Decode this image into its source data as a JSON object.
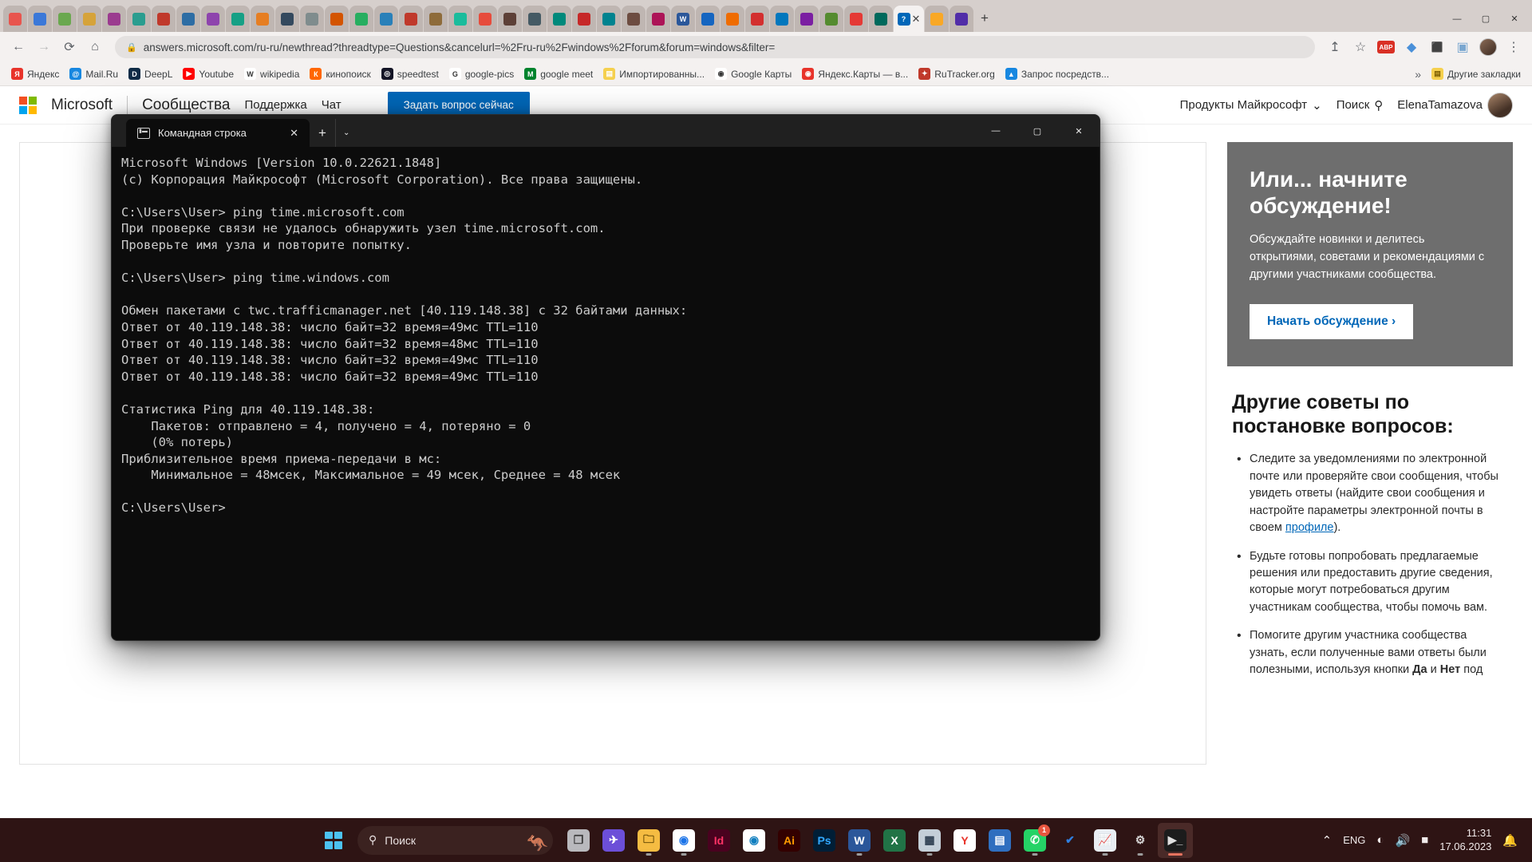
{
  "browser": {
    "tabs": [
      {
        "label": "",
        "color": "#e8554e"
      },
      {
        "label": "",
        "color": "#3b78d8"
      },
      {
        "label": "",
        "color": "#6aa84f"
      },
      {
        "label": "",
        "color": "#d6a33a"
      },
      {
        "label": "",
        "color": "#9b3b8f"
      },
      {
        "label": "",
        "color": "#2a9d8f"
      },
      {
        "label": "",
        "color": "#c0392b"
      },
      {
        "label": "",
        "color": "#2e6da4"
      },
      {
        "label": "",
        "color": "#8e44ad"
      },
      {
        "label": "",
        "color": "#16a085"
      },
      {
        "label": "",
        "color": "#e67e22"
      },
      {
        "label": "",
        "color": "#34495e"
      },
      {
        "label": "",
        "color": "#7f8c8d"
      },
      {
        "label": "",
        "color": "#d35400"
      },
      {
        "label": "",
        "color": "#27ae60"
      },
      {
        "label": "",
        "color": "#2980b9"
      },
      {
        "label": "",
        "color": "#c0392b"
      },
      {
        "label": "",
        "color": "#8e6b3a"
      },
      {
        "label": "",
        "color": "#1abc9c"
      },
      {
        "label": "",
        "color": "#e74c3c"
      },
      {
        "label": "",
        "color": "#5d4037"
      },
      {
        "label": "",
        "color": "#455a64"
      },
      {
        "label": "",
        "color": "#00897b"
      },
      {
        "label": "",
        "color": "#c62828"
      },
      {
        "label": "",
        "color": "#00838f"
      },
      {
        "label": "",
        "color": "#6d4c41"
      },
      {
        "label": "",
        "color": "#ad1457"
      },
      {
        "label": "W",
        "color": "#2b579a"
      },
      {
        "label": "",
        "color": "#1565c0"
      },
      {
        "label": "",
        "color": "#ef6c00"
      },
      {
        "label": "",
        "color": "#d32f2f"
      },
      {
        "label": "",
        "color": "#0277bd"
      },
      {
        "label": "",
        "color": "#7b1fa2"
      },
      {
        "label": "",
        "color": "#558b2f"
      },
      {
        "label": "",
        "color": "#e53935"
      },
      {
        "label": "",
        "color": "#00695c"
      },
      {
        "label": "?",
        "color": "#0067b8"
      },
      {
        "label": "",
        "color": "#f9a825"
      },
      {
        "label": "",
        "color": "#512da8"
      }
    ],
    "active_tab_label": "",
    "tab_close_glyph": "✕",
    "new_tab_glyph": "+",
    "window_minimize": "—",
    "window_maximize": "▢",
    "window_close": "✕",
    "nav": {
      "back": "←",
      "forward": "→",
      "reload": "⟳",
      "home": "⌂"
    },
    "omnibox": {
      "lock_glyph": "🔒",
      "url": "answers.microsoft.com/ru-ru/newthread?threadtype=Questions&cancelurl=%2Fru-ru%2Fwindows%2Fforum&forum=windows&filter=",
      "share_glyph": "↥",
      "star_glyph": "☆"
    },
    "toolbar_right": {
      "adblock_label": "ABP",
      "ext1_glyph": "◆",
      "ext2_glyph": "⬛",
      "ext3_glyph": "▣",
      "menu_glyph": "⋮"
    },
    "bookmarks": [
      {
        "label": "Яндекс",
        "icon": "Я",
        "color": "#e8332a"
      },
      {
        "label": "Mail.Ru",
        "icon": "@",
        "color": "#1787e0"
      },
      {
        "label": "DeepL",
        "icon": "D",
        "color": "#0f2b46"
      },
      {
        "label": "Youtube",
        "icon": "▶",
        "color": "#ff0000"
      },
      {
        "label": "wikipedia",
        "icon": "W",
        "color": "#ffffff"
      },
      {
        "label": "кинопоиск",
        "icon": "К",
        "color": "#ff6600"
      },
      {
        "label": "speedtest",
        "icon": "◎",
        "color": "#141526"
      },
      {
        "label": "google-pics",
        "icon": "G",
        "color": "#ffffff"
      },
      {
        "label": "google meet",
        "icon": "M",
        "color": "#00832d"
      },
      {
        "label": "Импортированны...",
        "icon": "▤",
        "color": "#f5d04e"
      },
      {
        "label": "Google Карты",
        "icon": "◉",
        "color": "#ffffff"
      },
      {
        "label": "Яндекс.Карты — в...",
        "icon": "◉",
        "color": "#e8332a"
      },
      {
        "label": "RuTracker.org",
        "icon": "✦",
        "color": "#c0392b"
      },
      {
        "label": "Запрос посредств...",
        "icon": "▲",
        "color": "#1787e0"
      }
    ],
    "bookmarks_overflow": "»",
    "other_bookmarks": {
      "label": "Другие закладки",
      "icon": "▤"
    }
  },
  "ms_page": {
    "brand": "Microsoft",
    "nav_items": [
      "Сообщества",
      "Поддержка",
      "Чат"
    ],
    "ask_button": "Задать вопрос сейчас",
    "products_menu": "Продукты Майкрософт",
    "products_chevron": "⌄",
    "search_label": "Поиск",
    "search_icon": "search-icon",
    "account_name": "ElenaTamazova",
    "promo": {
      "title": "Или... начните обсуждение!",
      "text": "Обсуждайте новинки и делитесь открытиями, советами и рекомендациями с другими участниками сообщества.",
      "button": "Начать обсуждение",
      "button_chevron": "›"
    },
    "tips": {
      "title": "Другие советы по постановке вопросов:",
      "items": [
        {
          "pre": "Следите за уведомлениями по электронной почте или проверяйте свои сообщения, чтобы увидеть ответы (найдите свои сообщения и настройте параметры электронной почты в своем ",
          "link": "профиле",
          "post": ")."
        },
        {
          "pre": "Будьте готовы попробовать предлагаемые решения или предоставить другие сведения, которые могут потребоваться другим участникам сообщества, чтобы помочь вам.",
          "link": "",
          "post": ""
        },
        {
          "pre": "Помогите другим участника сообщества узнать, если полученные вами ответы были полезными, используя кнопки ",
          "bold1": "Да",
          "mid": " и ",
          "bold2": "Нет",
          "post": " под"
        }
      ]
    }
  },
  "cmd": {
    "tab_title": "Командная строка",
    "tab_icon": "terminal-icon",
    "tab_close": "✕",
    "new_tab": "+",
    "dropdown": "⌄",
    "minimize": "—",
    "maximize": "▢",
    "close": "✕",
    "output": "Microsoft Windows [Version 10.0.22621.1848]\n(c) Корпорация Майкрософт (Microsoft Corporation). Все права защищены.\n\nC:\\Users\\User> ping time.microsoft.com\nПри проверке связи не удалось обнаружить узел time.microsoft.com.\nПроверьте имя узла и повторите попытку.\n\nC:\\Users\\User> ping time.windows.com\n\nОбмен пакетами с twc.trafficmanager.net [40.119.148.38] с 32 байтами данных:\nОтвет от 40.119.148.38: число байт=32 время=49мс TTL=110\nОтвет от 40.119.148.38: число байт=32 время=48мс TTL=110\nОтвет от 40.119.148.38: число байт=32 время=49мс TTL=110\nОтвет от 40.119.148.38: число байт=32 время=49мс TTL=110\n\nСтатистика Ping для 40.119.148.38:\n    Пакетов: отправлено = 4, получено = 4, потеряно = 0\n    (0% потерь)\nПриблизительное время приема-передачи в мс:\n    Минимальное = 48мсек, Максимальное = 49 мсек, Среднее = 48 мсек\n\nC:\\Users\\User>"
  },
  "taskbar": {
    "start_icon": "windows-logo-icon",
    "search_placeholder": "Поиск",
    "search_icon": "search-icon",
    "decoration": "🦘",
    "apps": [
      {
        "name": "task-view",
        "glyph": "❐",
        "bg": "#b9b9bd",
        "fg": "#3a3a3a",
        "dot": false,
        "badge": ""
      },
      {
        "name": "telegram",
        "glyph": "✈",
        "bg": "#6c4fd8",
        "fg": "#ffffff",
        "dot": false,
        "badge": ""
      },
      {
        "name": "file-explorer",
        "glyph": "🗀",
        "bg": "#f5bc42",
        "fg": "#5a4100",
        "dot": true,
        "badge": ""
      },
      {
        "name": "google-chrome",
        "glyph": "◉",
        "bg": "#ffffff",
        "fg": "#1a73e8",
        "dot": true,
        "badge": ""
      },
      {
        "name": "indesign",
        "glyph": "Id",
        "bg": "#49021f",
        "fg": "#ff3366",
        "dot": false,
        "badge": ""
      },
      {
        "name": "microsoft-edge",
        "glyph": "◉",
        "bg": "#ffffff",
        "fg": "#0f7ebf",
        "dot": false,
        "badge": ""
      },
      {
        "name": "illustrator",
        "glyph": "Ai",
        "bg": "#330000",
        "fg": "#ff9a00",
        "dot": false,
        "badge": ""
      },
      {
        "name": "photoshop",
        "glyph": "Ps",
        "bg": "#001e36",
        "fg": "#31a8ff",
        "dot": false,
        "badge": ""
      },
      {
        "name": "word",
        "glyph": "W",
        "bg": "#2b579a",
        "fg": "#ffffff",
        "dot": true,
        "badge": ""
      },
      {
        "name": "excel",
        "glyph": "X",
        "bg": "#217346",
        "fg": "#ffffff",
        "dot": false,
        "badge": ""
      },
      {
        "name": "calculator",
        "glyph": "▦",
        "bg": "#c4cfd8",
        "fg": "#2d3e50",
        "dot": true,
        "badge": ""
      },
      {
        "name": "yandex-browser",
        "glyph": "Y",
        "bg": "#ffffff",
        "fg": "#e8332a",
        "dot": false,
        "badge": ""
      },
      {
        "name": "notepad",
        "glyph": "▤",
        "bg": "#2f6fbf",
        "fg": "#ffffff",
        "dot": false,
        "badge": ""
      },
      {
        "name": "whatsapp",
        "glyph": "✆",
        "bg": "#25d366",
        "fg": "#ffffff",
        "dot": true,
        "badge": "1"
      },
      {
        "name": "todo",
        "glyph": "✔",
        "bg": "transparent",
        "fg": "#2f7fe0",
        "dot": false,
        "badge": ""
      },
      {
        "name": "task-manager",
        "glyph": "📈",
        "bg": "#e9eef3",
        "fg": "#2f6fbf",
        "dot": true,
        "badge": ""
      },
      {
        "name": "settings",
        "glyph": "⚙",
        "bg": "transparent",
        "fg": "#d8d8d8",
        "dot": true,
        "badge": ""
      },
      {
        "name": "command-prompt",
        "glyph": "▶_",
        "bg": "#1c1c1c",
        "fg": "#e0e0e0",
        "dot": true,
        "badge": "",
        "active": true
      }
    ],
    "tray": {
      "chevron": "⌃",
      "language": "ENG",
      "wifi": "wifi-icon",
      "volume": "speaker-icon",
      "battery": "battery-icon",
      "time": "11:31",
      "date": "17.06.2023",
      "notification": "notification-bell-icon"
    }
  }
}
